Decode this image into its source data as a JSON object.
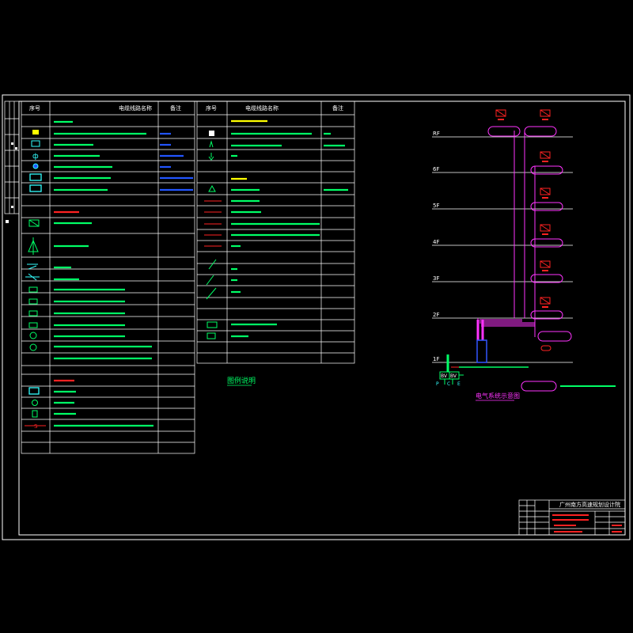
{
  "colors": {
    "background": "#000000",
    "frame": "#ffffff",
    "legend_text": "#00ff66",
    "legend_blue": "#2255ff",
    "legend_red": "#ff2222",
    "riser": "#ff33ff",
    "cyan": "#33ffff",
    "yellow": "#ffff00"
  },
  "legend_table_1": {
    "headers": [
      "序号",
      "电缆线路名称",
      "备注"
    ]
  },
  "legend_table_2": {
    "headers": [
      "序号",
      "电缆线路名称",
      "备注"
    ]
  },
  "legend_caption": "图例说明",
  "riser_diagram": {
    "floors": [
      "RF",
      "6F",
      "5F",
      "4F",
      "3F",
      "2F",
      "1F"
    ],
    "caption": "电气系统示意图",
    "bottom_labels": [
      "P",
      "C",
      "E"
    ],
    "box_labels": [
      "BV",
      "BV"
    ]
  },
  "title_block": {
    "institute": "广州南方高速规划设计院"
  }
}
